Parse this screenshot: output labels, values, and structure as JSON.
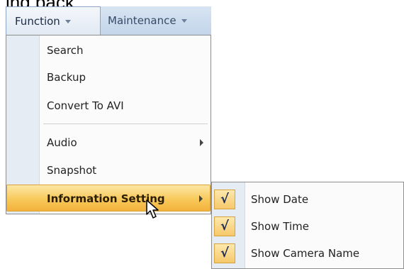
{
  "clipped_text": "ing back.",
  "menubar": {
    "function_label": "Function",
    "maintenance_label": "Maintenance"
  },
  "menu": {
    "items": [
      {
        "label": "Search"
      },
      {
        "label": "Backup"
      },
      {
        "label": "Convert To AVI"
      },
      {
        "label": "Audio"
      },
      {
        "label": "Snapshot"
      },
      {
        "label": "Information Setting"
      }
    ]
  },
  "submenu": {
    "items": [
      {
        "label": "Show Date",
        "checked": true
      },
      {
        "label": "Show Time",
        "checked": true
      },
      {
        "label": "Show Camera Name",
        "checked": true
      }
    ],
    "check_glyph": "√"
  },
  "icons": {
    "dropdown_arrow": "chevron-down-icon",
    "submenu_arrow": "chevron-right-icon",
    "pointer": "mouse-pointer-icon"
  },
  "colors": {
    "highlight": "#f8c95a",
    "menubar": "#c3d5ea"
  }
}
